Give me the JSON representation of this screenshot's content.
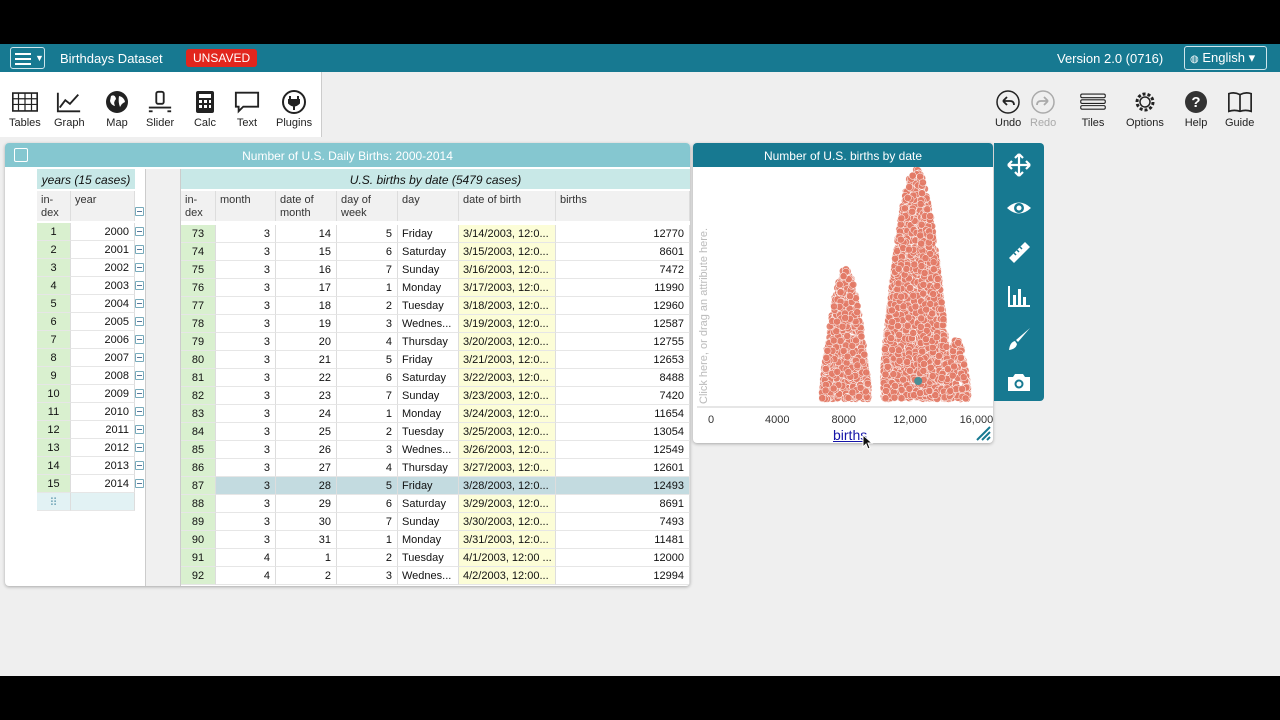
{
  "topbar": {
    "title": "Birthdays Dataset",
    "unsaved_badge": "UNSAVED",
    "version": "Version 2.0 (0716)",
    "language": "English ▾"
  },
  "toolshelf": {
    "left": [
      "Tables",
      "Graph",
      "Map",
      "Slider",
      "Calc",
      "Text",
      "Plugins"
    ],
    "right": [
      "Undo",
      "Redo",
      "Tiles",
      "Options",
      "Help",
      "Guide"
    ]
  },
  "table": {
    "title": "Number of U.S. Daily Births: 2000-2014",
    "parent_collection": "years (15 cases)",
    "child_collection": "U.S. births by date (5479 cases)",
    "parent_columns": [
      "in-\ndex",
      "year"
    ],
    "parent_rows": [
      [
        "1",
        "2000"
      ],
      [
        "2",
        "2001"
      ],
      [
        "3",
        "2002"
      ],
      [
        "4",
        "2003"
      ],
      [
        "5",
        "2004"
      ],
      [
        "6",
        "2005"
      ],
      [
        "7",
        "2006"
      ],
      [
        "8",
        "2007"
      ],
      [
        "9",
        "2008"
      ],
      [
        "10",
        "2009"
      ],
      [
        "11",
        "2010"
      ],
      [
        "12",
        "2011"
      ],
      [
        "13",
        "2012"
      ],
      [
        "14",
        "2013"
      ],
      [
        "15",
        "2014"
      ]
    ],
    "child_columns": [
      "in-\ndex",
      "month",
      "date of\nmonth",
      "day of\nweek",
      "day",
      "date of birth",
      "births"
    ],
    "child_rows": [
      [
        "73",
        "3",
        "14",
        "5",
        "Friday",
        "3/14/2003, 12:0...",
        "12770"
      ],
      [
        "74",
        "3",
        "15",
        "6",
        "Saturday",
        "3/15/2003, 12:0...",
        "8601"
      ],
      [
        "75",
        "3",
        "16",
        "7",
        "Sunday",
        "3/16/2003, 12:0...",
        "7472"
      ],
      [
        "76",
        "3",
        "17",
        "1",
        "Monday",
        "3/17/2003, 12:0...",
        "11990"
      ],
      [
        "77",
        "3",
        "18",
        "2",
        "Tuesday",
        "3/18/2003, 12:0...",
        "12960"
      ],
      [
        "78",
        "3",
        "19",
        "3",
        "Wednes...",
        "3/19/2003, 12:0...",
        "12587"
      ],
      [
        "79",
        "3",
        "20",
        "4",
        "Thursday",
        "3/20/2003, 12:0...",
        "12755"
      ],
      [
        "80",
        "3",
        "21",
        "5",
        "Friday",
        "3/21/2003, 12:0...",
        "12653"
      ],
      [
        "81",
        "3",
        "22",
        "6",
        "Saturday",
        "3/22/2003, 12:0...",
        "8488"
      ],
      [
        "82",
        "3",
        "23",
        "7",
        "Sunday",
        "3/23/2003, 12:0...",
        "7420"
      ],
      [
        "83",
        "3",
        "24",
        "1",
        "Monday",
        "3/24/2003, 12:0...",
        "11654"
      ],
      [
        "84",
        "3",
        "25",
        "2",
        "Tuesday",
        "3/25/2003, 12:0...",
        "13054"
      ],
      [
        "85",
        "3",
        "26",
        "3",
        "Wednes...",
        "3/26/2003, 12:0...",
        "12549"
      ],
      [
        "86",
        "3",
        "27",
        "4",
        "Thursday",
        "3/27/2003, 12:0...",
        "12601"
      ],
      [
        "87",
        "3",
        "28",
        "5",
        "Friday",
        "3/28/2003, 12:0...",
        "12493"
      ],
      [
        "88",
        "3",
        "29",
        "6",
        "Saturday",
        "3/29/2003, 12:0...",
        "8691"
      ],
      [
        "89",
        "3",
        "30",
        "7",
        "Sunday",
        "3/30/2003, 12:0...",
        "7493"
      ],
      [
        "90",
        "3",
        "31",
        "1",
        "Monday",
        "3/31/2003, 12:0...",
        "11481"
      ],
      [
        "91",
        "4",
        "1",
        "2",
        "Tuesday",
        "4/1/2003, 12:00 ...",
        "12000"
      ],
      [
        "92",
        "4",
        "2",
        "3",
        "Wednes...",
        "4/2/2003, 12:00...",
        "12994"
      ]
    ],
    "selected_row_index": "87"
  },
  "graph": {
    "title": "Number of U.S. births by date",
    "y_prompt": "Click here, or drag an attribute here.",
    "x_attribute": "births",
    "chart_data": {
      "type": "scatter",
      "x_ticks": [
        "0",
        "4000",
        "8000",
        "12,000",
        "16,000"
      ],
      "xlim": [
        -600,
        17000
      ],
      "point_color": "#e27a66",
      "selected_point_color": "#4a8f96",
      "selected_point_value": 12493,
      "clusters": [
        {
          "x_range": [
            6700,
            9500
          ],
          "count": 1100
        },
        {
          "x_range": [
            10400,
            14300
          ],
          "count": 3000
        },
        {
          "x_range": [
            12600,
            15500
          ],
          "count": 550
        }
      ]
    }
  },
  "inspector": [
    "resize-icon",
    "eye-icon",
    "ruler-icon",
    "chart-icon",
    "brush-icon",
    "camera-icon"
  ],
  "colors": {
    "brand": "#177991",
    "unsaved": "#e2261d",
    "table_header": "#85c7d0"
  }
}
